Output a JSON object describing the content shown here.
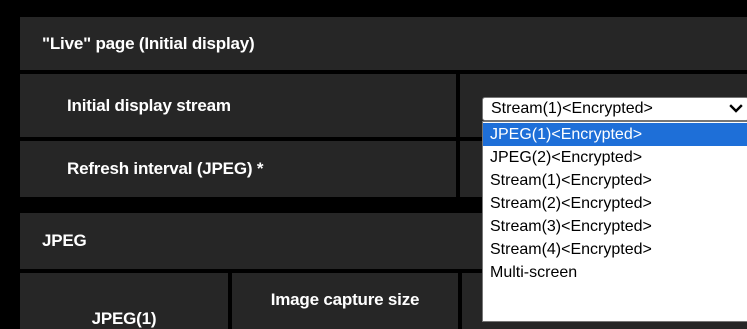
{
  "live_section": {
    "title": "\"Live\" page (Initial display)",
    "initial_stream_label": "Initial display stream",
    "refresh_interval_label": "Refresh interval (JPEG) *"
  },
  "jpeg_section": {
    "title": "JPEG",
    "jpeg1_label": "JPEG(1)",
    "image_capture_size_label": "Image capture size"
  },
  "stream_select": {
    "value": "Stream(1)<Encrypted>",
    "icon": "chevron-down-icon",
    "options": [
      "JPEG(1)<Encrypted>",
      "JPEG(2)<Encrypted>",
      "Stream(1)<Encrypted>",
      "Stream(2)<Encrypted>",
      "Stream(3)<Encrypted>",
      "Stream(4)<Encrypted>",
      "Multi-screen"
    ],
    "highlighted_option": "JPEG(1)<Encrypted>",
    "highlight_color": "#1e6fd8"
  }
}
